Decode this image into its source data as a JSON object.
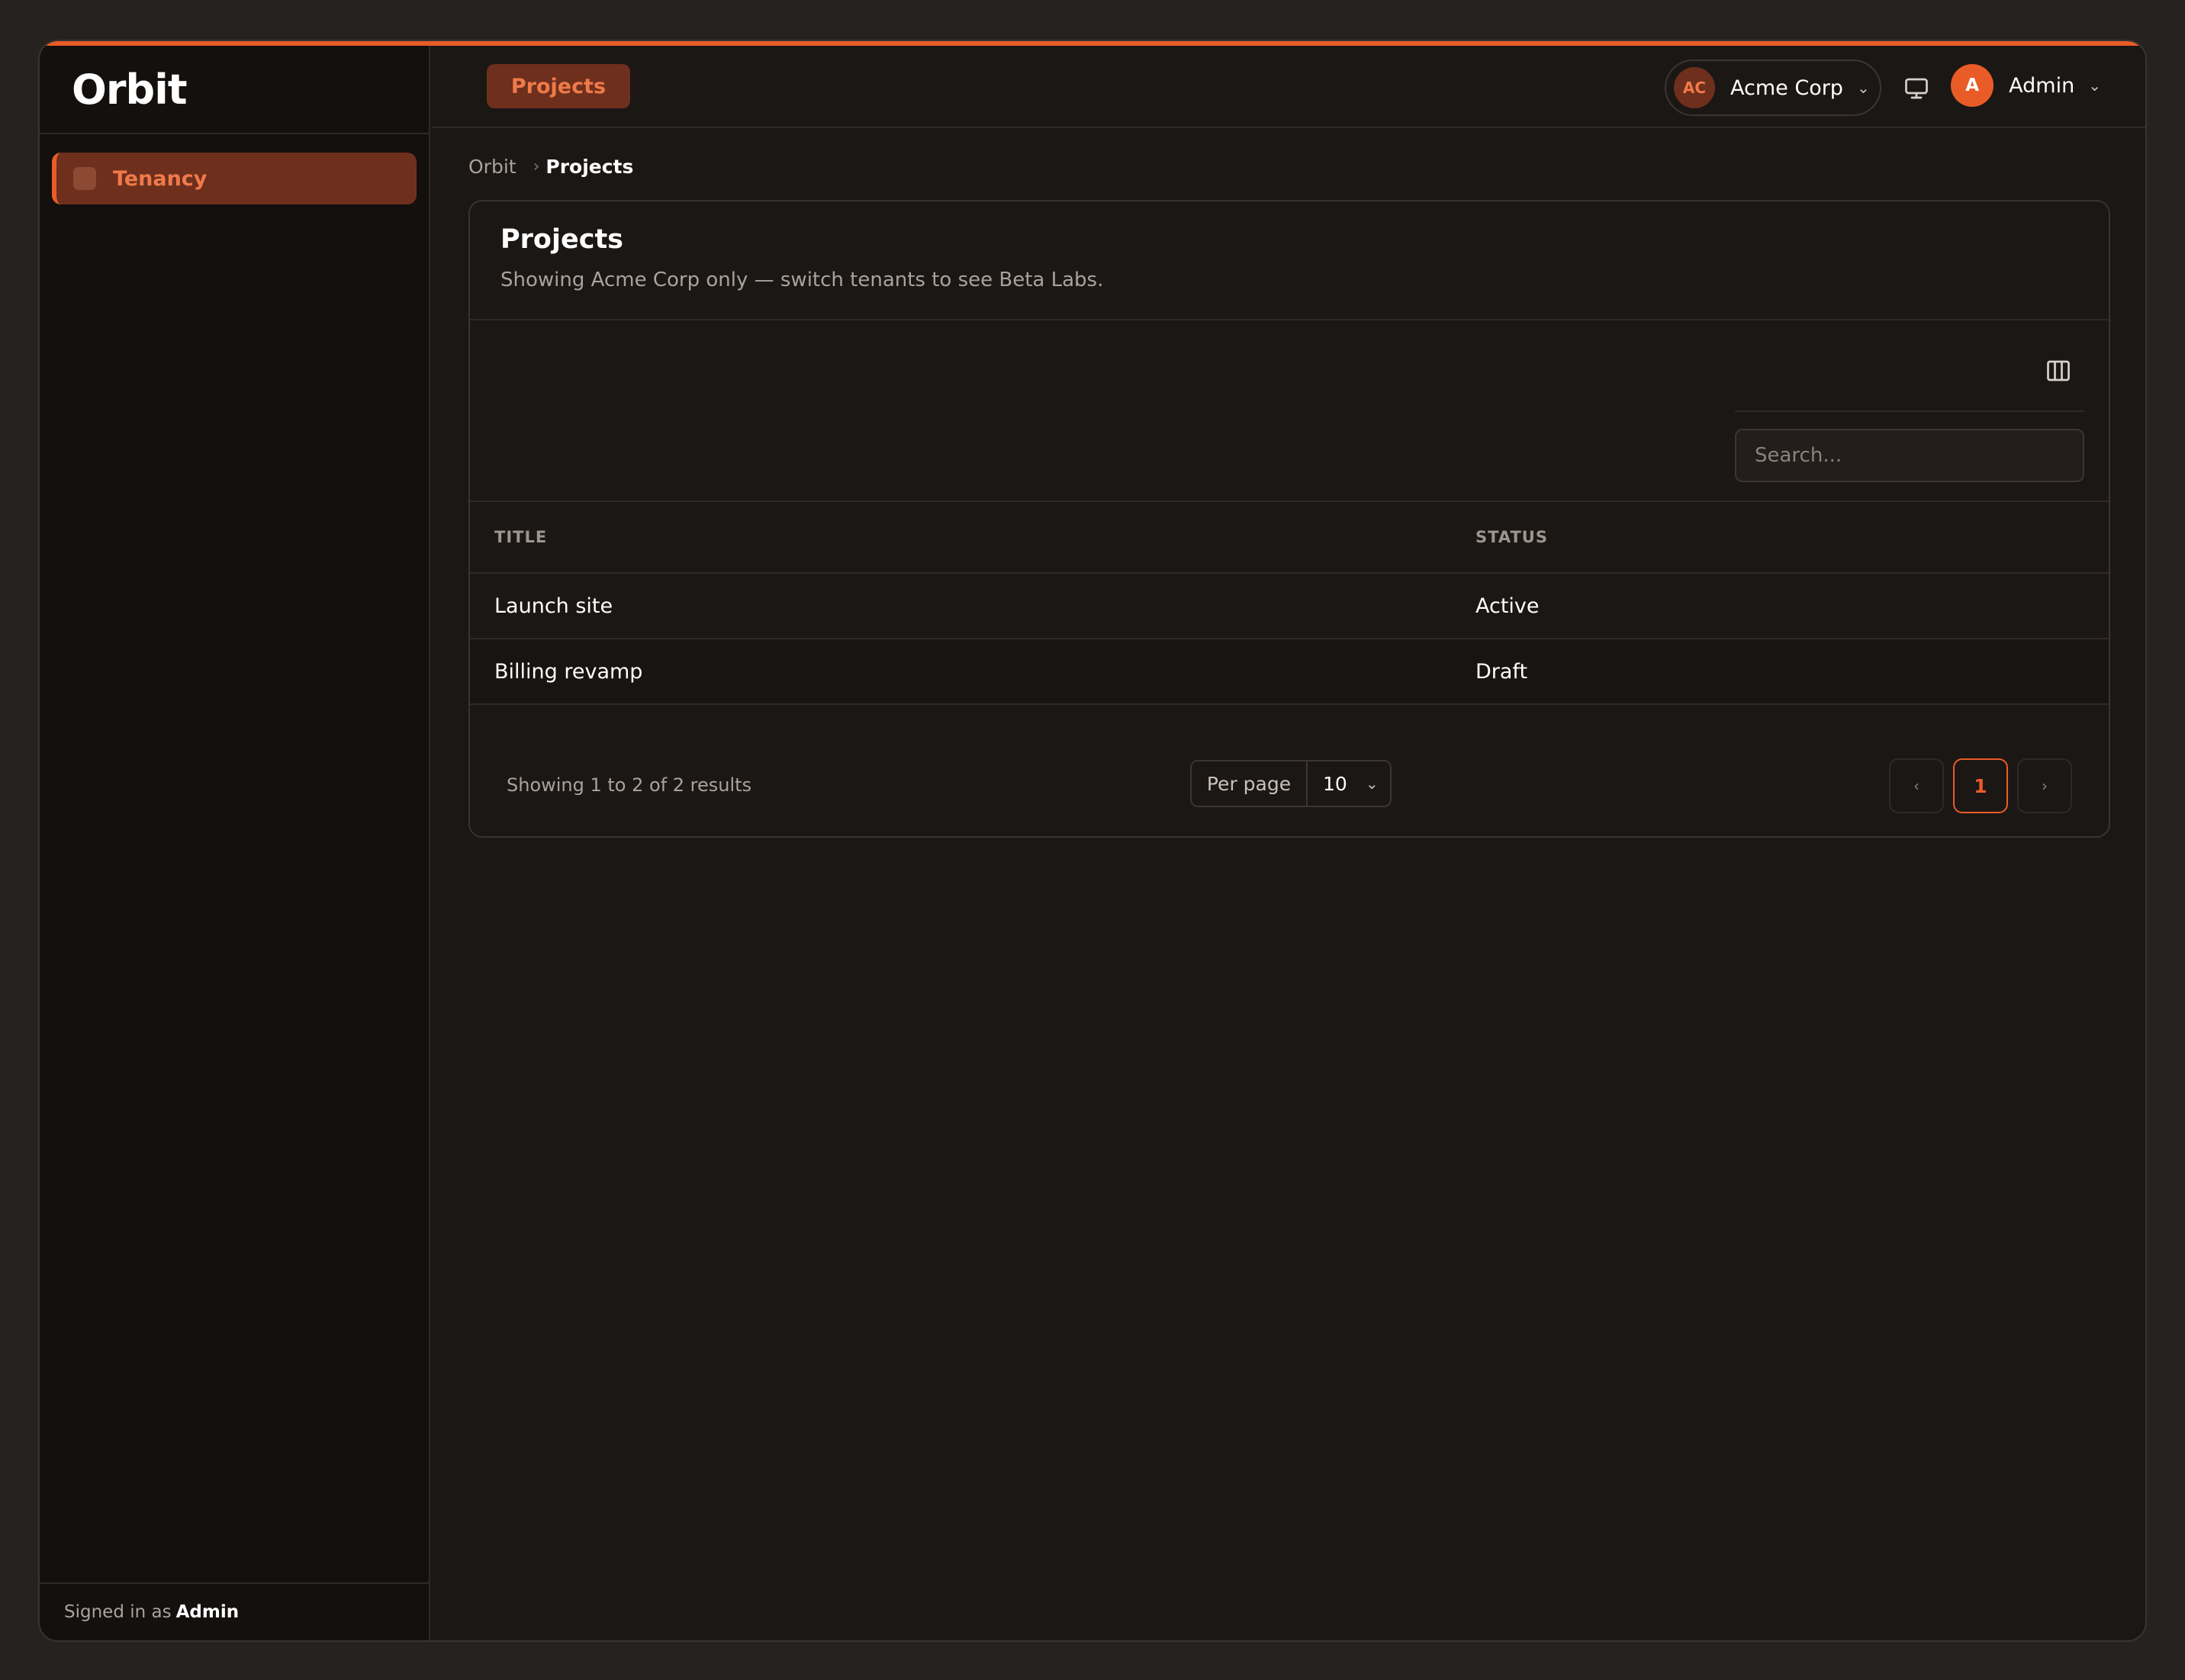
{
  "brand": "Orbit",
  "sidebar": {
    "items": [
      {
        "label": "Tenancy",
        "icon": "tenancy-icon",
        "active": true
      }
    ],
    "footer": {
      "prefix": "Signed in as",
      "user": "Admin"
    }
  },
  "topbar": {
    "tab": "Projects",
    "tenant": {
      "initials": "AC",
      "name": "Acme Corp"
    },
    "user": {
      "initial": "A",
      "name": "Admin"
    }
  },
  "breadcrumb": {
    "root": "Orbit",
    "current": "Projects"
  },
  "card": {
    "title": "Projects",
    "subtitle": "Showing Acme Corp only — switch tenants to see Beta Labs."
  },
  "search": {
    "placeholder": "Search..."
  },
  "table": {
    "columns": [
      "TITLE",
      "STATUS"
    ],
    "rows": [
      {
        "title": "Launch site",
        "status": "Active"
      },
      {
        "title": "Billing revamp",
        "status": "Draft"
      }
    ]
  },
  "footer": {
    "results": "Showing 1 to 2 of 2 results",
    "per_page_label": "Per page",
    "per_page_value": "10",
    "prev": "‹",
    "page": "1",
    "next": "›"
  },
  "colors": {
    "accent": "#ea5c27",
    "background": "#1b1715"
  }
}
